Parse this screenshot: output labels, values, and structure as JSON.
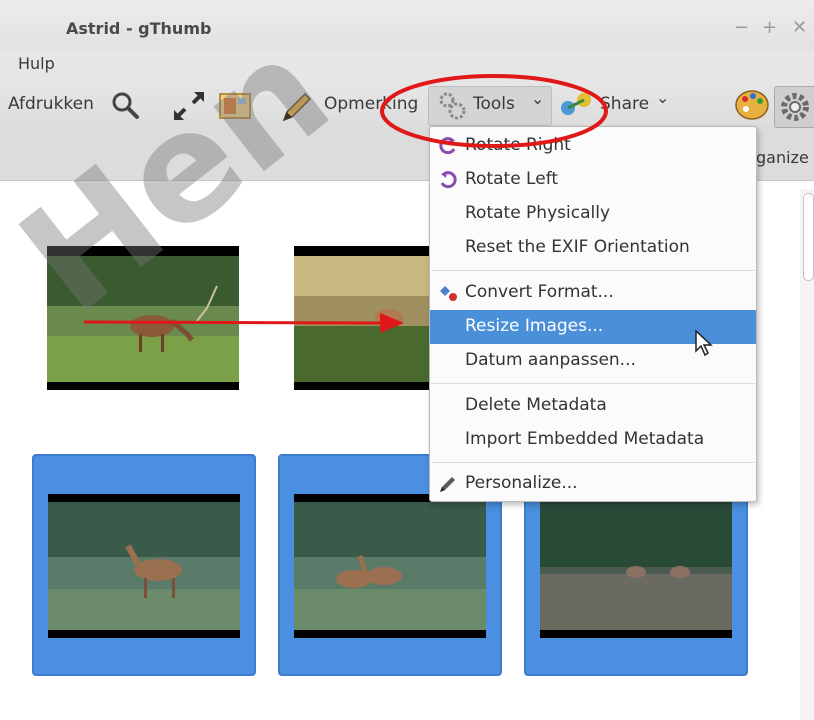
{
  "window": {
    "title": "Astrid - gThumb",
    "controls": [
      "−",
      "+",
      "✕"
    ]
  },
  "menubar": {
    "items": [
      "Hulp"
    ]
  },
  "toolbar": {
    "print_label": "Afdrukken",
    "comment_label": "Opmerking",
    "tools_label": "Tools",
    "share_label": "Share",
    "dropdown_glyph": "⌄"
  },
  "subbar": {
    "organize_label": "ganize"
  },
  "tools_menu": {
    "items": [
      {
        "label": "Rotate Right",
        "icon": "rotate-right-icon"
      },
      {
        "label": "Rotate Left",
        "icon": "rotate-left-icon"
      },
      {
        "label": "Rotate Physically",
        "icon": ""
      },
      {
        "label": "Reset the EXIF Orientation",
        "icon": ""
      },
      {
        "label": "Convert Format...",
        "icon": "convert-format-icon"
      },
      {
        "label": "Resize Images...",
        "icon": "",
        "highlighted": true
      },
      {
        "label": "Datum aanpassen...",
        "icon": ""
      },
      {
        "label": "Delete Metadata",
        "icon": ""
      },
      {
        "label": "Import Embedded Metadata",
        "icon": ""
      },
      {
        "label": "Personalize...",
        "icon": "pencil-icon"
      }
    ]
  },
  "watermark": {
    "text": "Hen"
  },
  "colors": {
    "highlight": "#4a90d9",
    "selection_frame": "#4a8fe0",
    "annotation_red": "#e01818"
  }
}
